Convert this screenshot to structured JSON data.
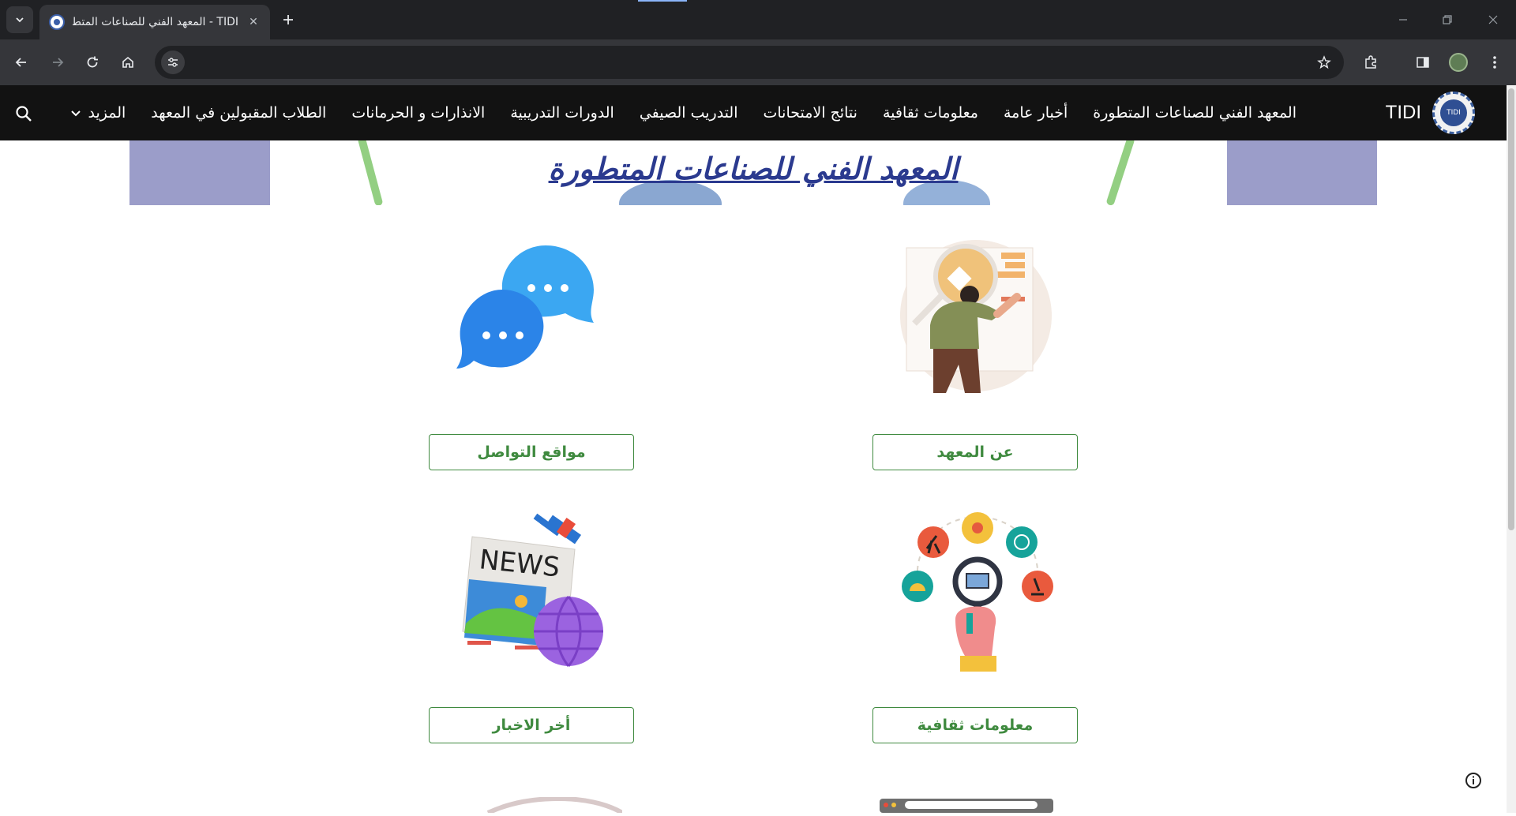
{
  "browser": {
    "tab_title": "TIDI - المعهد الفني للصناعات المتطورة",
    "address": "",
    "close_glyph": "✕"
  },
  "nav": {
    "brand": "TIDI",
    "logo_text": "TIDI",
    "links": [
      "المعهد الفني للصناعات المتطورة",
      "أخبار عامة",
      "معلومات ثقافية",
      "نتائج الامتحانات",
      "التدريب الصيفي",
      "الدورات التدريبية",
      "الانذارات و الحرمانات",
      "الطلاب المقبولين في المعهد"
    ],
    "more": "المزيد"
  },
  "hero": {
    "title": "المعهد الفني للصناعات المتطورة"
  },
  "cards": {
    "about": "عن المعهد",
    "social": "مواقع التواصل",
    "culture": "معلومات ثقافية",
    "news": "أخر الاخبار"
  },
  "colors": {
    "accent_green": "#3f8a3f",
    "title_blue": "#2b3a8f",
    "nav_bg": "#121212"
  },
  "icons": [
    "search-icon",
    "chevron-down-icon",
    "info-icon",
    "star-icon",
    "extensions-icon",
    "back-icon",
    "forward-icon",
    "reload-icon",
    "home-icon"
  ]
}
